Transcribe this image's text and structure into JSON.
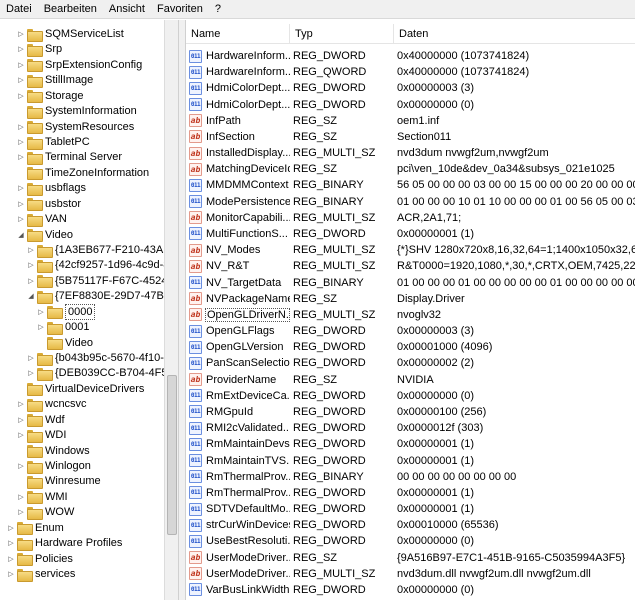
{
  "menubar": [
    "Datei",
    "Bearbeiten",
    "Ansicht",
    "Favoriten",
    "?"
  ],
  "tree": [
    {
      "label": "SQMServiceList",
      "level": 1,
      "expander": "collapsed"
    },
    {
      "label": "Srp",
      "level": 1,
      "expander": "collapsed"
    },
    {
      "label": "SrpExtensionConfig",
      "level": 1,
      "expander": "collapsed"
    },
    {
      "label": "StillImage",
      "level": 1,
      "expander": "collapsed"
    },
    {
      "label": "Storage",
      "level": 1,
      "expander": "collapsed"
    },
    {
      "label": "SystemInformation",
      "level": 1,
      "expander": "none"
    },
    {
      "label": "SystemResources",
      "level": 1,
      "expander": "collapsed"
    },
    {
      "label": "TabletPC",
      "level": 1,
      "expander": "collapsed"
    },
    {
      "label": "Terminal Server",
      "level": 1,
      "expander": "collapsed"
    },
    {
      "label": "TimeZoneInformation",
      "level": 1,
      "expander": "none"
    },
    {
      "label": "usbflags",
      "level": 1,
      "expander": "collapsed"
    },
    {
      "label": "usbstor",
      "level": 1,
      "expander": "collapsed"
    },
    {
      "label": "VAN",
      "level": 1,
      "expander": "collapsed"
    },
    {
      "label": "Video",
      "level": 1,
      "expander": "expanded"
    },
    {
      "label": "{1A3EB677-F210-43AE-85",
      "level": 2,
      "expander": "collapsed"
    },
    {
      "label": "{42cf9257-1d96-4c9d-87f",
      "level": 2,
      "expander": "collapsed"
    },
    {
      "label": "{5B75117F-F67C-4524-94",
      "level": 2,
      "expander": "collapsed"
    },
    {
      "label": "{7EF8830E-29D7-47BD-86",
      "level": 2,
      "expander": "expanded"
    },
    {
      "label": "0000",
      "level": 3,
      "expander": "collapsed",
      "selected": true
    },
    {
      "label": "0001",
      "level": 3,
      "expander": "collapsed"
    },
    {
      "label": "Video",
      "level": 3,
      "expander": "none"
    },
    {
      "label": "{b043b95c-5670-4f10-b9",
      "level": 2,
      "expander": "collapsed"
    },
    {
      "label": "{DEB039CC-B704-4F53-B",
      "level": 2,
      "expander": "collapsed"
    },
    {
      "label": "VirtualDeviceDrivers",
      "level": 1,
      "expander": "none"
    },
    {
      "label": "wcncsvc",
      "level": 1,
      "expander": "collapsed"
    },
    {
      "label": "Wdf",
      "level": 1,
      "expander": "collapsed"
    },
    {
      "label": "WDI",
      "level": 1,
      "expander": "collapsed"
    },
    {
      "label": "Windows",
      "level": 1,
      "expander": "none"
    },
    {
      "label": "Winlogon",
      "level": 1,
      "expander": "collapsed"
    },
    {
      "label": "Winresume",
      "level": 1,
      "expander": "none"
    },
    {
      "label": "WMI",
      "level": 1,
      "expander": "collapsed"
    },
    {
      "label": "WOW",
      "level": 1,
      "expander": "collapsed"
    },
    {
      "label": "Enum",
      "level": 0,
      "expander": "collapsed"
    },
    {
      "label": "Hardware Profiles",
      "level": 0,
      "expander": "collapsed"
    },
    {
      "label": "Policies",
      "level": 0,
      "expander": "collapsed"
    },
    {
      "label": "services",
      "level": 0,
      "expander": "collapsed"
    }
  ],
  "columns": {
    "name": "Name",
    "type": "Typ",
    "data": "Daten"
  },
  "values": [
    {
      "name": "HardwareInform...",
      "type": "REG_DWORD",
      "data": "0x40000000 (1073741824)",
      "icon": "bin"
    },
    {
      "name": "HardwareInform...",
      "type": "REG_QWORD",
      "data": "0x40000000 (1073741824)",
      "icon": "bin"
    },
    {
      "name": "HdmiColorDept...",
      "type": "REG_DWORD",
      "data": "0x00000003 (3)",
      "icon": "bin"
    },
    {
      "name": "HdmiColorDept...",
      "type": "REG_DWORD",
      "data": "0x00000000 (0)",
      "icon": "bin"
    },
    {
      "name": "InfPath",
      "type": "REG_SZ",
      "data": "oem1.inf",
      "icon": "str"
    },
    {
      "name": "InfSection",
      "type": "REG_SZ",
      "data": "Section011",
      "icon": "str"
    },
    {
      "name": "InstalledDisplay...",
      "type": "REG_MULTI_SZ",
      "data": "nvd3dum nvwgf2um,nvwgf2um",
      "icon": "str"
    },
    {
      "name": "MatchingDeviceId",
      "type": "REG_SZ",
      "data": "pci\\ven_10de&dev_0a34&subsys_021e1025",
      "icon": "str"
    },
    {
      "name": "MMDMMContext",
      "type": "REG_BINARY",
      "data": "56 05 00 00 00 03 00 00 15 00 00 00 20 00 00 00 00 00...",
      "icon": "bin"
    },
    {
      "name": "ModePersistence",
      "type": "REG_BINARY",
      "data": "01 00 00 00 10 01 10 00 00 00 01 00 56 05 00 03 20 3c...",
      "icon": "bin"
    },
    {
      "name": "MonitorCapabili...",
      "type": "REG_MULTI_SZ",
      "data": "ACR,2A1,71;",
      "icon": "str"
    },
    {
      "name": "MultiFunctionS...",
      "type": "REG_DWORD",
      "data": "0x00000001 (1)",
      "icon": "bin"
    },
    {
      "name": "NV_Modes",
      "type": "REG_MULTI_SZ",
      "data": "{*}SHV 1280x720x8,16,32,64=1;1400x1050x32,64 160...",
      "icon": "str"
    },
    {
      "name": "NV_R&T",
      "type": "REG_MULTI_SZ",
      "data": "R&T0000=1920,1080,*,30,*,CRTX,OEM,7425,2200,4...",
      "icon": "str"
    },
    {
      "name": "NV_TargetData",
      "type": "REG_BINARY",
      "data": "01 00 00 00 01 00 00 00 00 00 01 00 00 00 00 00 10 01...",
      "icon": "bin"
    },
    {
      "name": "NVPackageName",
      "type": "REG_SZ",
      "data": "Display.Driver",
      "icon": "str"
    },
    {
      "name": "OpenGLDriverN...",
      "type": "REG_MULTI_SZ",
      "data": "nvoglv32",
      "icon": "str",
      "selected": true
    },
    {
      "name": "OpenGLFlags",
      "type": "REG_DWORD",
      "data": "0x00000003 (3)",
      "icon": "bin"
    },
    {
      "name": "OpenGLVersion",
      "type": "REG_DWORD",
      "data": "0x00001000 (4096)",
      "icon": "bin"
    },
    {
      "name": "PanScanSelection",
      "type": "REG_DWORD",
      "data": "0x00000002 (2)",
      "icon": "bin"
    },
    {
      "name": "ProviderName",
      "type": "REG_SZ",
      "data": "NVIDIA",
      "icon": "str"
    },
    {
      "name": "RmExtDeviceCa...",
      "type": "REG_DWORD",
      "data": "0x00000000 (0)",
      "icon": "bin"
    },
    {
      "name": "RMGpuId",
      "type": "REG_DWORD",
      "data": "0x00000100 (256)",
      "icon": "bin"
    },
    {
      "name": "RMI2cValidated...",
      "type": "REG_DWORD",
      "data": "0x0000012f (303)",
      "icon": "bin"
    },
    {
      "name": "RmMaintainDevs",
      "type": "REG_DWORD",
      "data": "0x00000001 (1)",
      "icon": "bin"
    },
    {
      "name": "RmMaintainTVS...",
      "type": "REG_DWORD",
      "data": "0x00000001 (1)",
      "icon": "bin"
    },
    {
      "name": "RmThermalProv...",
      "type": "REG_BINARY",
      "data": "00 00 00 00 00 00 00 00",
      "icon": "bin"
    },
    {
      "name": "RmThermalProv...",
      "type": "REG_DWORD",
      "data": "0x00000001 (1)",
      "icon": "bin"
    },
    {
      "name": "SDTVDefaultMo...",
      "type": "REG_DWORD",
      "data": "0x00000001 (1)",
      "icon": "bin"
    },
    {
      "name": "strCurWinDevices",
      "type": "REG_DWORD",
      "data": "0x00010000 (65536)",
      "icon": "bin"
    },
    {
      "name": "UseBestResoluti...",
      "type": "REG_DWORD",
      "data": "0x00000000 (0)",
      "icon": "bin"
    },
    {
      "name": "UserModeDriver...",
      "type": "REG_SZ",
      "data": "{9A516B97-E7C1-451B-9165-C5035994A3F5}",
      "icon": "str"
    },
    {
      "name": "UserModeDriver...",
      "type": "REG_MULTI_SZ",
      "data": "nvd3dum.dll nvwgf2um.dll nvwgf2um.dll",
      "icon": "str"
    },
    {
      "name": "VarBusLinkWidth",
      "type": "REG_DWORD",
      "data": "0x00000000 (0)",
      "icon": "bin"
    }
  ],
  "icons": {
    "binary_value": "binary-value-icon",
    "string_value": "string-value-icon",
    "folder": "folder-icon"
  },
  "colors": {
    "chrome": "#f0f0f0",
    "folder": "#e6b946",
    "binary_icon": "#1e4fc9",
    "string_icon": "#c0351e"
  }
}
